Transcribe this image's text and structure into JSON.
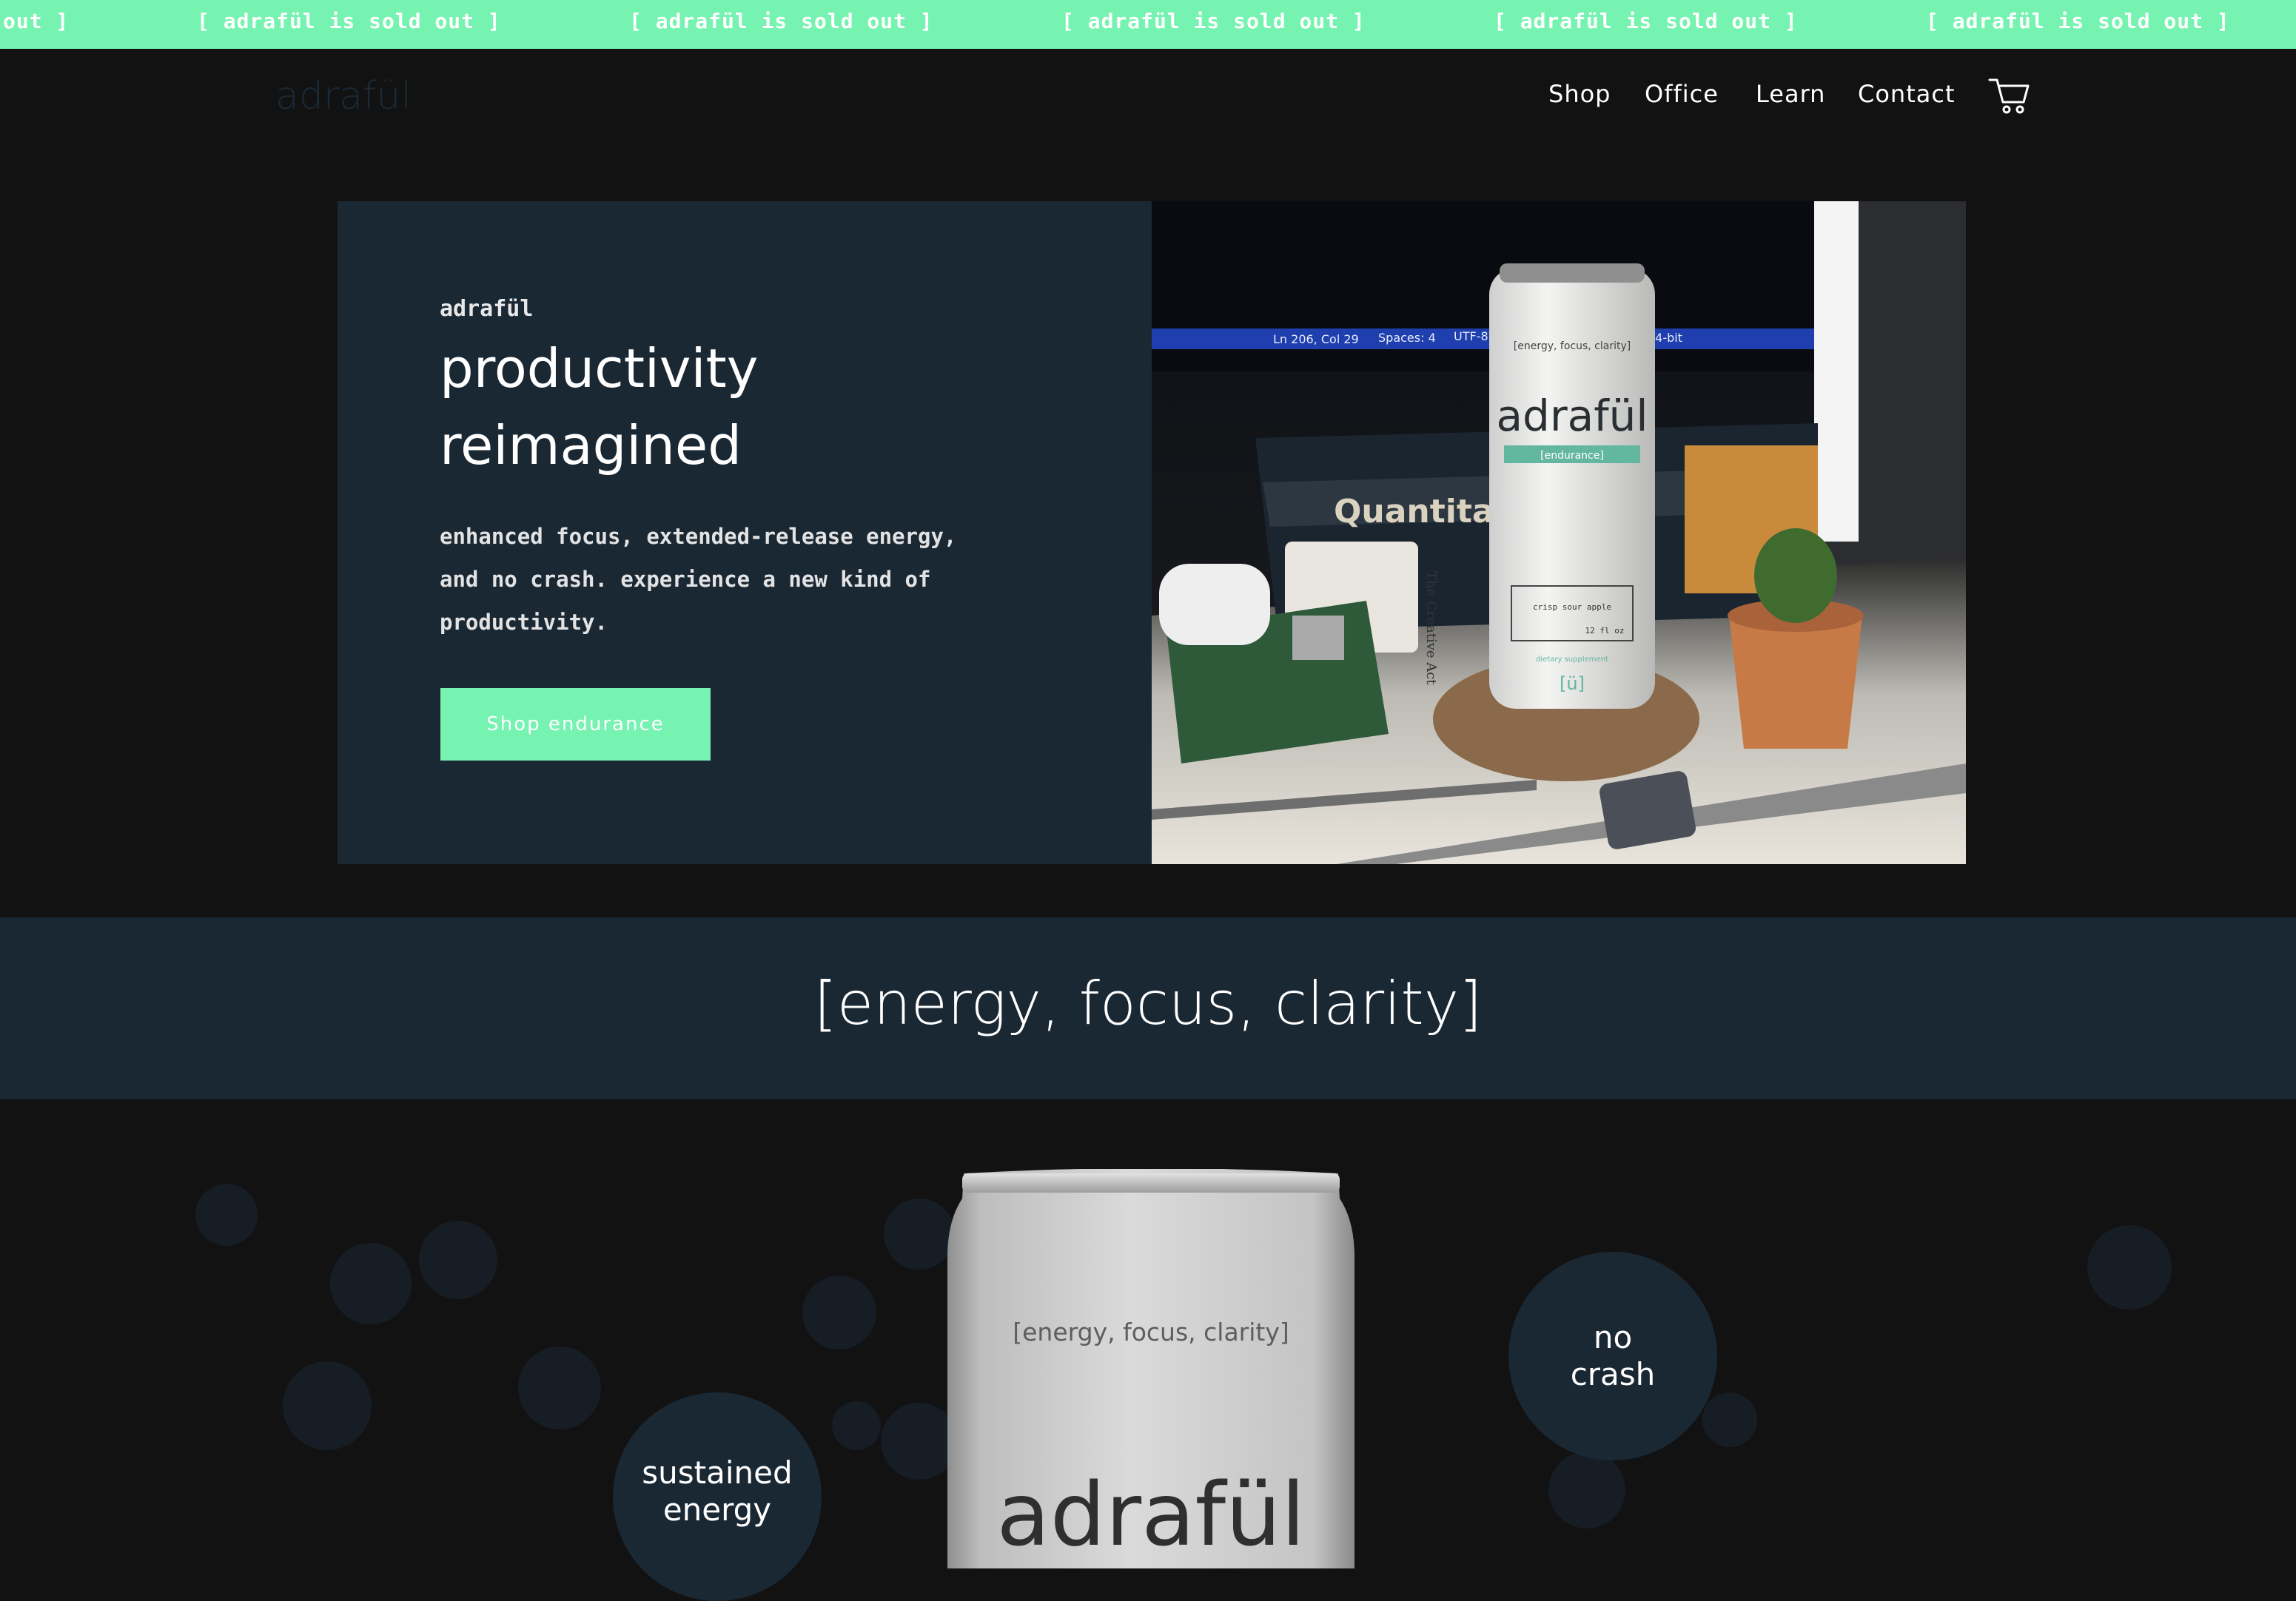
{
  "announcement": {
    "items": [
      "out ]",
      "[ adrafül is sold out ]",
      "[ adrafül is sold out ]",
      "[ adrafül is sold out ]",
      "[ adrafül is sold out ]",
      "[ adrafül is sold out ]"
    ]
  },
  "header": {
    "logo": "adrafül",
    "nav": [
      "Shop",
      "Office",
      "Learn",
      "Contact"
    ],
    "cart_icon": "cart-icon"
  },
  "hero": {
    "kicker": "adrafül",
    "title_line1": "productivity",
    "title_line2": "reimagined",
    "body_line1": "enhanced focus, extended-release energy,",
    "body_line2": "and no crash. experience a new kind of",
    "body_line3": "productivity.",
    "cta": "Shop endurance",
    "photo": {
      "editor_status_1": "Ln 206, Col 29",
      "editor_status_2": "Spaces: 4",
      "editor_status_3": "UTF-8",
      "editor_status_4": "64-bit",
      "book_title": "Quantitat",
      "book_spine": "The Creative Act",
      "can_tagline": "[energy, focus, clarity]",
      "can_brand": "adrafül",
      "can_variant": "[endurance]",
      "can_flavor": "crisp sour apple",
      "can_volume": "12 fl oz",
      "can_note": "dietary supplement",
      "can_mark": "[ü]"
    }
  },
  "tagline": "[energy, focus, clarity]",
  "product": {
    "can_tagline": "[energy, focus, clarity]",
    "can_brand": "adrafül",
    "feature_no_crash": [
      "no",
      "crash"
    ],
    "feature_sustained": [
      "sustained",
      "energy"
    ]
  },
  "colors": {
    "accent": "#77f3b1",
    "panel": "#1a2834",
    "background": "#121212"
  }
}
